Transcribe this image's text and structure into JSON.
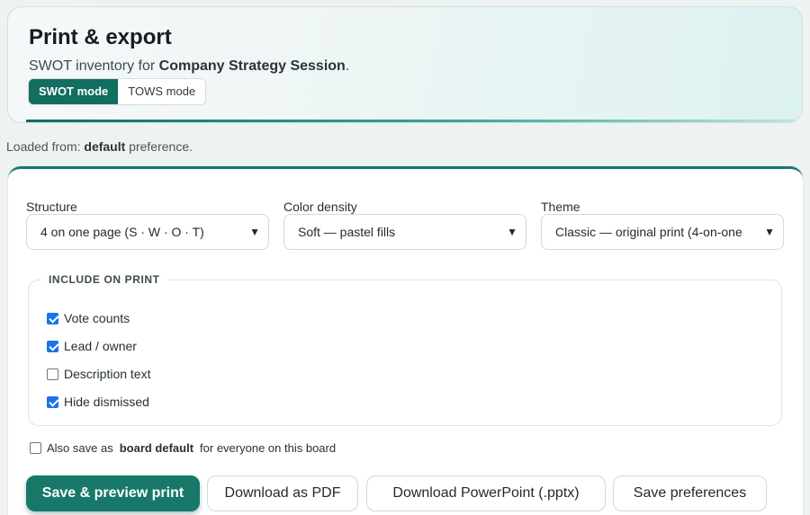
{
  "header": {
    "title": "Print & export",
    "subtitle_prefix": "SWOT inventory for ",
    "subtitle_session": "Company Strategy Session",
    "subtitle_suffix": ".",
    "modes": [
      {
        "label": "SWOT mode",
        "active": true
      },
      {
        "label": "TOWS mode",
        "active": false
      }
    ]
  },
  "loaded": {
    "prefix": "Loaded from: ",
    "source": "default",
    "suffix": " preference."
  },
  "form": {
    "structure": {
      "label": "Structure",
      "value": "4 on one page (S · W · O · T)"
    },
    "color_density": {
      "label": "Color density",
      "value": "Soft — pastel fills"
    },
    "theme": {
      "label": "Theme",
      "value": "Classic — original print (4-on-one"
    }
  },
  "include": {
    "legend": "INCLUDE ON PRINT",
    "options": [
      {
        "label": "Vote counts",
        "checked": true
      },
      {
        "label": "Lead / owner",
        "checked": true
      },
      {
        "label": "Description text",
        "checked": false
      },
      {
        "label": "Hide dismissed",
        "checked": true
      }
    ]
  },
  "board_default": {
    "prefix": "Also save as",
    "bold": "board default",
    "suffix": "for everyone on this board",
    "checked": false
  },
  "actions": {
    "preview": "Save & preview print",
    "pdf": "Download as PDF",
    "pptx": "Download PowerPoint (.pptx)",
    "save_prefs": "Save preferences"
  },
  "colors": {
    "accent": "#17786a",
    "checkbox": "#1a73e8"
  }
}
